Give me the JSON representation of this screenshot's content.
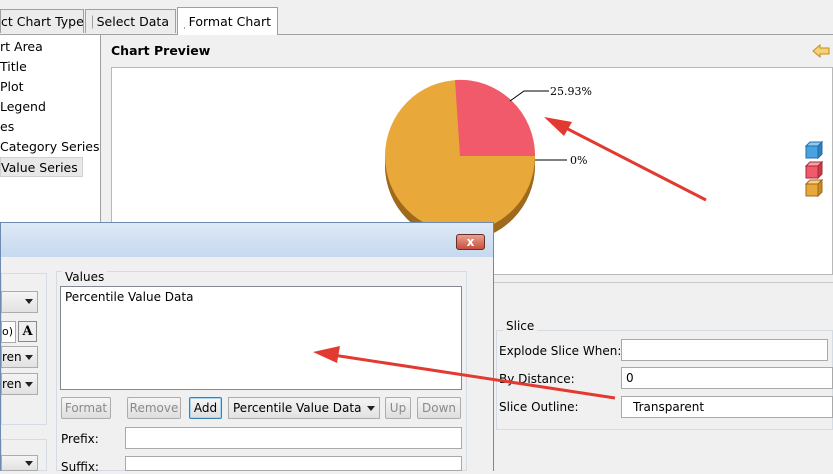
{
  "tabs": [
    {
      "label": "ct Chart Type"
    },
    {
      "label": "Select Data"
    },
    {
      "label": "Format Chart"
    }
  ],
  "tree": {
    "items": [
      "rt Area",
      "Title",
      "Plot",
      "Legend",
      "es",
      "Category Series",
      "Value Series"
    ]
  },
  "preview": {
    "title": "Chart Preview",
    "label_top": "25.93%",
    "label_right": "0%"
  },
  "chart_data": {
    "type": "pie",
    "values": [
      25.93,
      0,
      74.07
    ],
    "labels": [
      "25.93%",
      "0%",
      ""
    ],
    "colors": [
      "#f05a6a",
      "#4aa3df",
      "#e8a83a"
    ]
  },
  "slice": {
    "group_label": "Slice",
    "explode_label": "Explode Slice When:",
    "explode_value": "",
    "distance_label": "By Distance:",
    "distance_value": "0",
    "outline_label": "Slice Outline:",
    "outline_value": "Transparent"
  },
  "dialog": {
    "close_label": "x",
    "values_label": "Values",
    "values_item": "Percentile Value Data",
    "format_btn": "Format",
    "remove_btn": "Remove",
    "add_btn": "Add",
    "combo_value": "Percentile Value Data",
    "up_btn": "Up",
    "down_btn": "Down",
    "prefix_label": "Prefix:",
    "suffix_label": "Suffix:",
    "bold_a": "A",
    "left_field_text": "o)",
    "left_combo1": "ren",
    "left_combo2": "ren"
  },
  "colors": {
    "accent_arrow": "#e23a30",
    "pie_orange": "#e8a83a",
    "pie_red": "#f05a6a"
  }
}
